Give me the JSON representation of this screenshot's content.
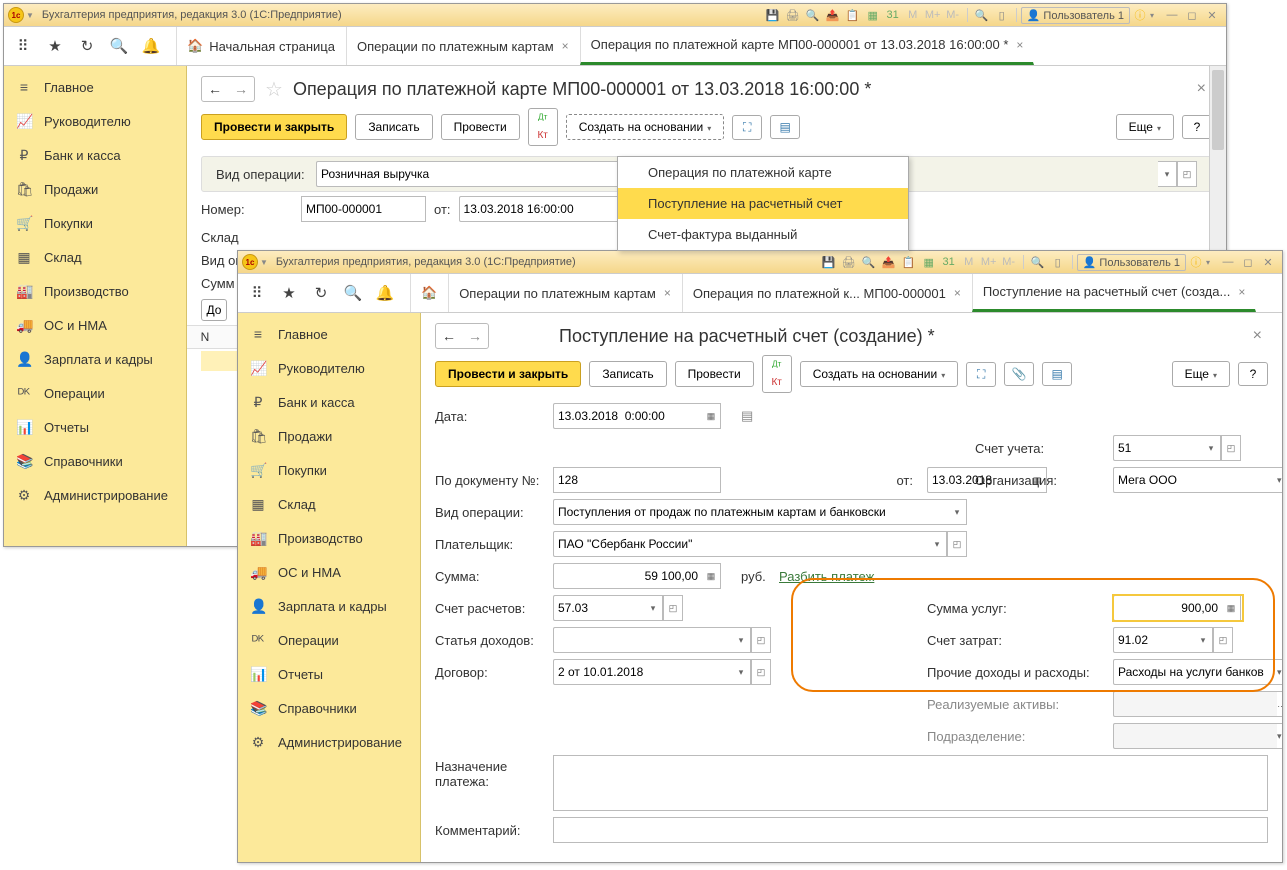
{
  "win1": {
    "title": "Бухгалтерия предприятия, редакция 3.0  (1С:Предприятие)",
    "user": "Пользователь 1",
    "tabs": {
      "home": "Начальная страница",
      "t1": "Операции по платежным картам",
      "t2": "Операция по платежной карте МП00-000001 от 13.03.2018 16:00:00 *"
    },
    "header": "Операция по платежной карте МП00-000001 от 13.03.2018 16:00:00 *",
    "buttons": {
      "post_close": "Провести и закрыть",
      "write": "Записать",
      "post": "Провести",
      "create_based": "Создать на основании",
      "more": "Еще"
    },
    "dropdown": {
      "i1": "Операция по платежной карте",
      "i2": "Поступление на расчетный счет",
      "i3": "Счет-фактура выданный"
    },
    "fields": {
      "op_type_lbl": "Вид операции:",
      "op_type_val": "Розничная выручка",
      "num_lbl": "Номер:",
      "num_val": "МП00-000001",
      "from_lbl": "от:",
      "date_val": "13.03.2018 16:00:00",
      "store_lbl": "Склад",
      "op_view_lbl": "Вид оп",
      "sum_lbl": "Сумм",
      "add_btn": "До",
      "col_n": "N"
    }
  },
  "sidebar": {
    "items": [
      {
        "ic": "≡",
        "label": "Главное"
      },
      {
        "ic": "📈",
        "label": "Руководителю"
      },
      {
        "ic": "₽",
        "label": "Банк и касса"
      },
      {
        "ic": "🛍",
        "label": "Продажи"
      },
      {
        "ic": "🛒",
        "label": "Покупки"
      },
      {
        "ic": "▦",
        "label": "Склад"
      },
      {
        "ic": "🏭",
        "label": "Производство"
      },
      {
        "ic": "🚚",
        "label": "ОС и НМА"
      },
      {
        "ic": "👤",
        "label": "Зарплата и кадры"
      },
      {
        "ic": "ᴰᴷ",
        "label": "Операции"
      },
      {
        "ic": "📊",
        "label": "Отчеты"
      },
      {
        "ic": "📚",
        "label": "Справочники"
      },
      {
        "ic": "⚙",
        "label": "Администрирование"
      }
    ]
  },
  "win2": {
    "title": "Бухгалтерия предприятия, редакция 3.0  (1С:Предприятие)",
    "user": "Пользователь 1",
    "tabs": {
      "t1": "Операции по платежным картам",
      "t2": "Операция по платежной к... МП00-000001",
      "t3": "Поступление на расчетный счет (созда..."
    },
    "header": "Поступление на расчетный счет (создание) *",
    "buttons": {
      "post_close": "Провести и закрыть",
      "write": "Записать",
      "post": "Провести",
      "create_based": "Создать на основании",
      "more": "Еще"
    },
    "fields": {
      "date_lbl": "Дата:",
      "date_val": "13.03.2018  0:00:00",
      "acc_lbl": "Счет учета:",
      "acc_val": "51",
      "docnum_lbl": "По документу №:",
      "docnum_val": "128",
      "from_lbl": "от:",
      "from_val": "13.03.2018",
      "org_lbl": "Организация:",
      "org_val": "Мега ООО",
      "optype_lbl": "Вид операции:",
      "optype_val": "Поступления от продаж по платежным картам и банковски",
      "payer_lbl": "Плательщик:",
      "payer_val": "ПАО \"Сбербанк России\"",
      "sum_lbl": "Сумма:",
      "sum_val": "59 100,00",
      "rub": "руб.",
      "split": "Разбить платеж",
      "acct_lbl": "Счет расчетов:",
      "acct_val": "57.03",
      "serv_lbl": "Сумма услуг:",
      "serv_val": "900,00",
      "cost_lbl": "Счет затрат:",
      "cost_val": "91.02",
      "inc_lbl": "Статья доходов:",
      "other_lbl": "Прочие доходы и расходы:",
      "other_val": "Расходы на услуги банков",
      "contract_lbl": "Договор:",
      "contract_val": "2 от 10.01.2018",
      "assets_lbl": "Реализуемые активы:",
      "dept_lbl": "Подразделение:",
      "purpose_lbl": "Назначение платежа:",
      "comment_lbl": "Комментарий:"
    }
  }
}
